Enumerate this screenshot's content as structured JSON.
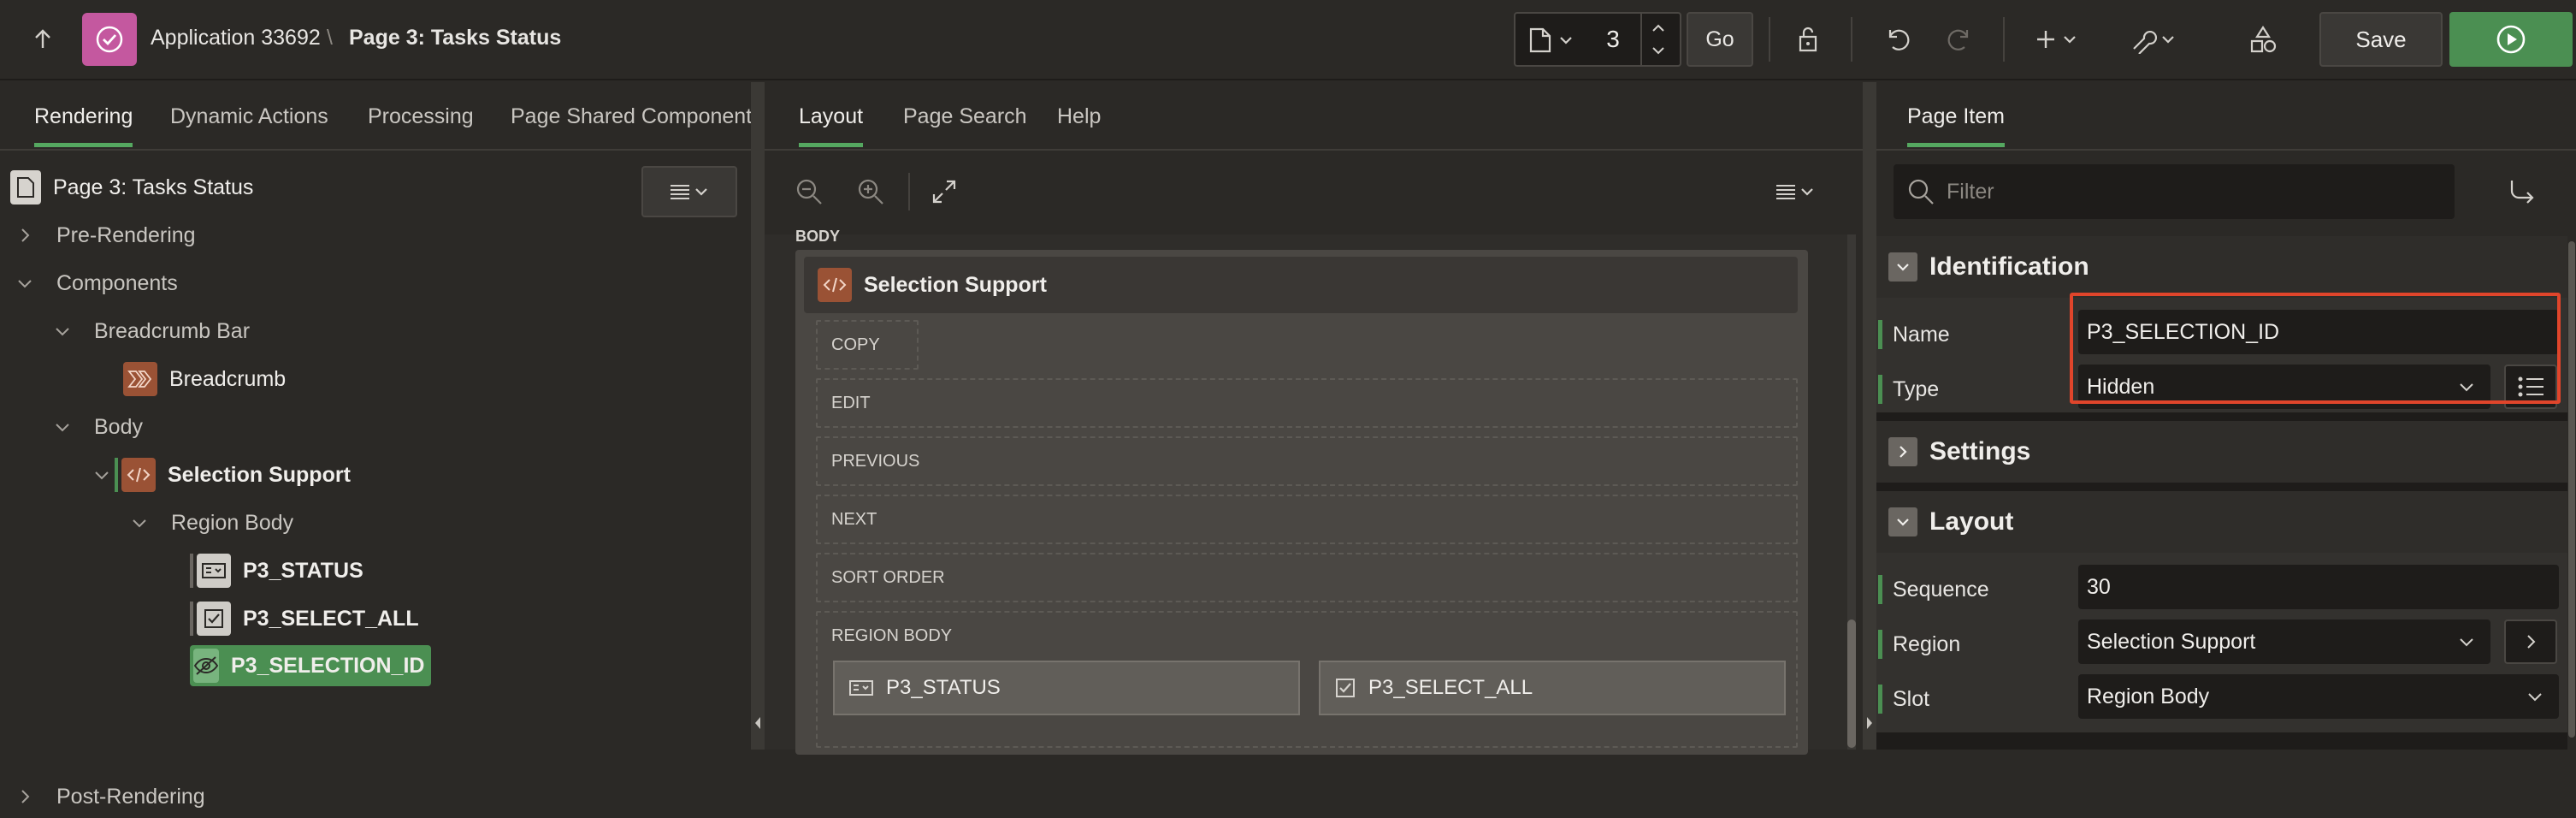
{
  "header": {
    "application": "Application 33692",
    "separator": "\\",
    "page_title": "Page 3: Tasks Status",
    "page_number": "3",
    "go_label": "Go",
    "save_label": "Save"
  },
  "rendering": {
    "tabs": [
      "Rendering",
      "Dynamic Actions",
      "Processing",
      "Page Shared Components"
    ],
    "tree": {
      "root": "Page 3: Tasks Status",
      "pre_rendering": "Pre-Rendering",
      "components": "Components",
      "breadcrumb_bar": "Breadcrumb Bar",
      "breadcrumb": "Breadcrumb",
      "body": "Body",
      "selection_support": "Selection Support",
      "region_body": "Region Body",
      "items": [
        "P3_STATUS",
        "P3_SELECT_ALL",
        "P3_SELECTION_ID"
      ],
      "post_rendering": "Post-Rendering"
    }
  },
  "layout": {
    "tabs": [
      "Layout",
      "Page Search",
      "Help"
    ],
    "body_label": "BODY",
    "region_title": "Selection Support",
    "slots": [
      "COPY",
      "EDIT",
      "PREVIOUS",
      "NEXT",
      "SORT ORDER",
      "REGION BODY"
    ],
    "items": [
      "P3_STATUS",
      "P3_SELECT_ALL"
    ]
  },
  "property_editor": {
    "tab": "Page Item",
    "filter_placeholder": "Filter",
    "groups": {
      "identification": "Identification",
      "settings": "Settings",
      "layout": "Layout"
    },
    "identification": {
      "name_label": "Name",
      "name_value": "P3_SELECTION_ID",
      "type_label": "Type",
      "type_value": "Hidden"
    },
    "layout": {
      "sequence_label": "Sequence",
      "sequence_value": "30",
      "region_label": "Region",
      "region_value": "Selection Support",
      "slot_label": "Slot",
      "slot_value": "Region Body"
    }
  },
  "colors": {
    "accent_green": "#4b8f52",
    "app_icon": "#c4589f",
    "highlight": "#e0452b",
    "region_icon": "#9a5235"
  }
}
